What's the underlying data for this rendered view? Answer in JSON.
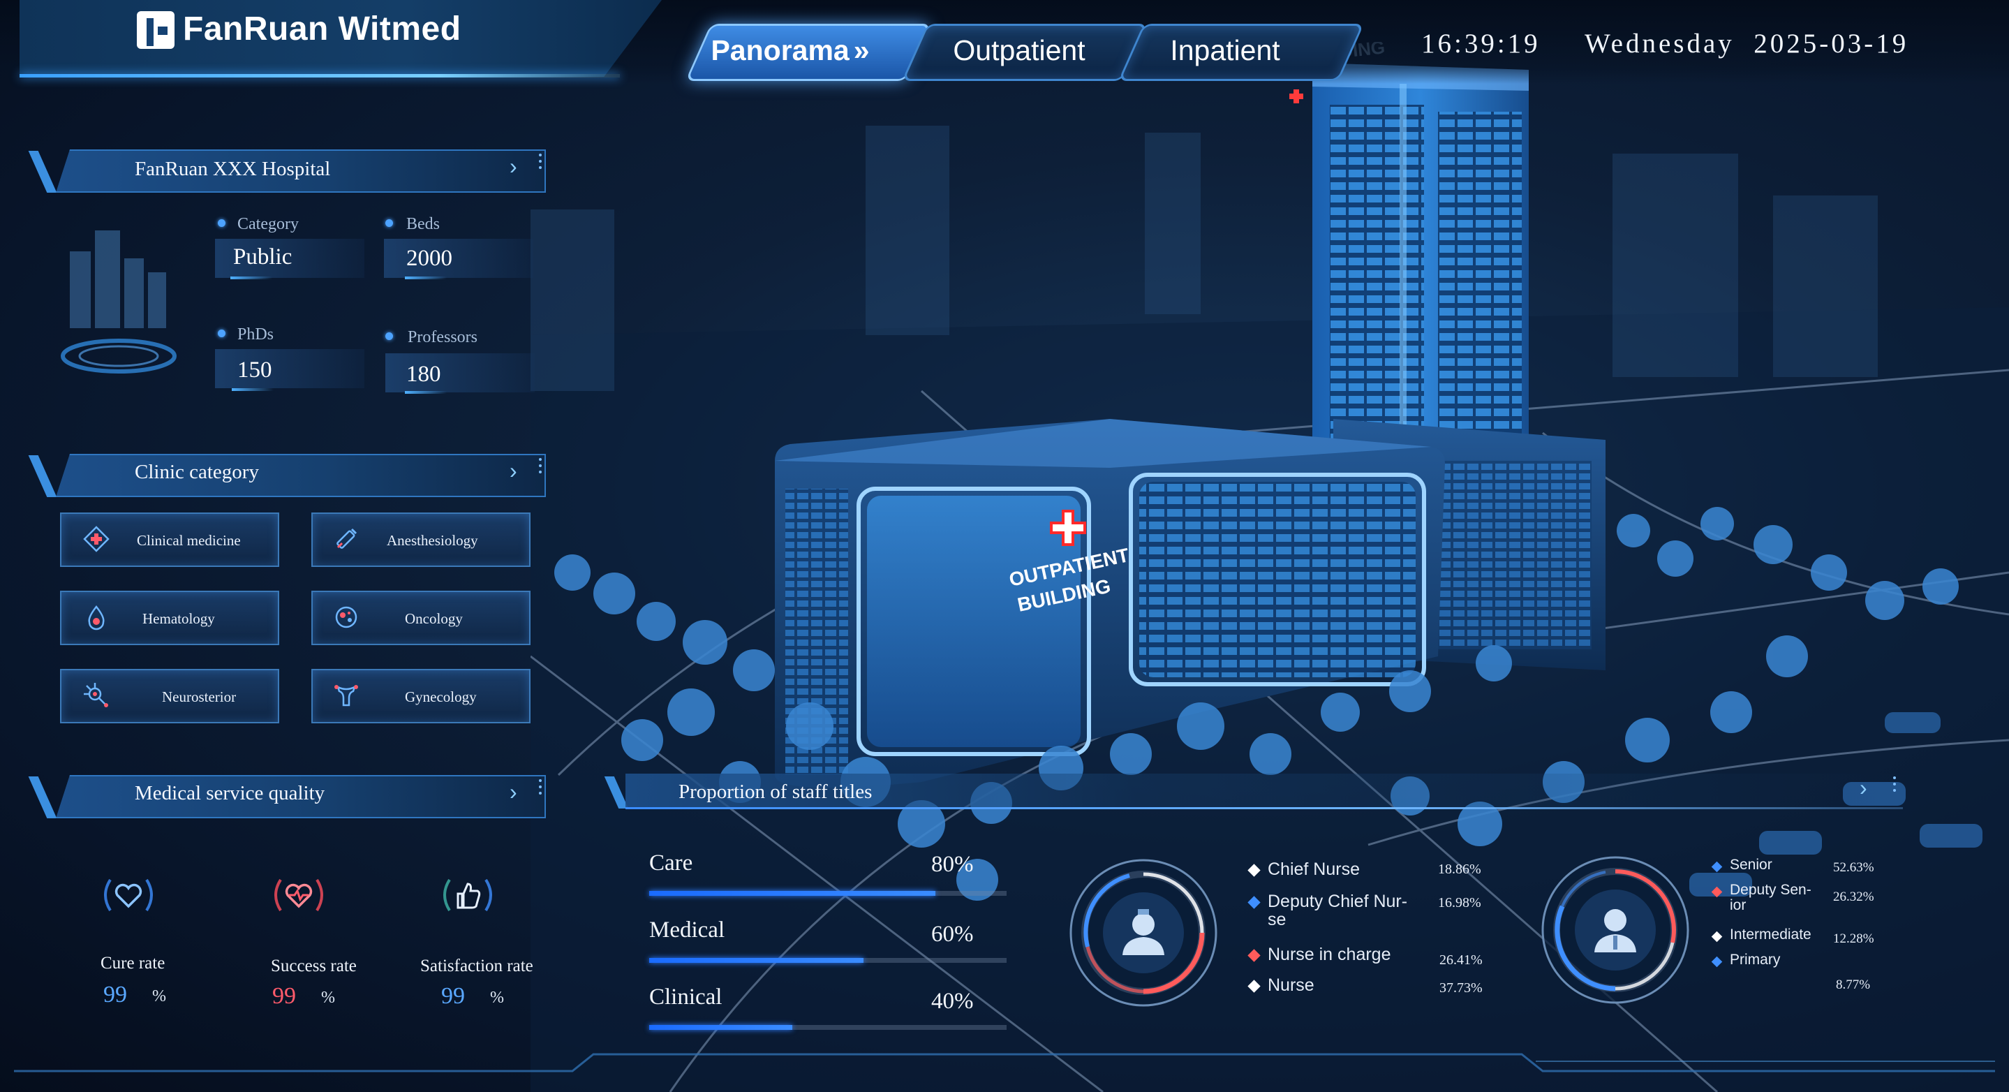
{
  "app": {
    "brand": "FanRuan Witmed"
  },
  "nav": {
    "tabs": [
      {
        "label": "Panorama",
        "active": true
      },
      {
        "label": "Outpatient",
        "active": false
      },
      {
        "label": "Inpatient",
        "active": false
      }
    ],
    "chevron": "»"
  },
  "header": {
    "time": "16:39:19",
    "date": "Wednesday  2025-03-19"
  },
  "scene": {
    "outpatient_sign": [
      "OUTPATIENT",
      "BUILDING"
    ],
    "inpatient_sign": "INPATIENT BUILDING"
  },
  "hospital": {
    "title": "FanRuan XXX Hospital",
    "fields": [
      {
        "key": "Category",
        "value": "Public"
      },
      {
        "key": "Beds",
        "value": "2000"
      },
      {
        "key": "PhDs",
        "value": "150"
      },
      {
        "key": "Professors",
        "value": "180"
      }
    ]
  },
  "clinic": {
    "title": "Clinic category",
    "items": [
      {
        "label": "Clinical medicine",
        "icon": "medical-cross-icon"
      },
      {
        "label": "Anesthesiology",
        "icon": "syringe-icon"
      },
      {
        "label": "Hematology",
        "icon": "blood-drop-icon"
      },
      {
        "label": "Oncology",
        "icon": "cell-icon"
      },
      {
        "label": "Neurosterior",
        "icon": "neuron-icon"
      },
      {
        "label": "Gynecology",
        "icon": "uterus-icon"
      }
    ]
  },
  "quality": {
    "title": "Medical service quality",
    "metrics": [
      {
        "label": "Cure rate",
        "value": "99",
        "unit": "%",
        "color": "#5aa8ff",
        "icon": "heart-icon"
      },
      {
        "label": "Success rate",
        "value": "99",
        "unit": "%",
        "color": "#ff5b6b",
        "icon": "heartbeat-icon"
      },
      {
        "label": "Satisfaction rate",
        "value": "99",
        "unit": "%",
        "color": "#5aa8ff",
        "icon": "thumbs-up-icon"
      }
    ]
  },
  "staff": {
    "title": "Proportion of staff titles",
    "bars": [
      {
        "name": "Care",
        "pct": "80%",
        "value": 0.8
      },
      {
        "name": "Medical",
        "pct": "60%",
        "value": 0.6
      },
      {
        "name": "Clinical",
        "pct": "40%",
        "value": 0.4
      }
    ],
    "nurse_legend": [
      {
        "name": "Chief Nurse",
        "pct": "18.86%",
        "color": "#ffffff"
      },
      {
        "name": "Deputy Chief Nur-\nse",
        "pct": "16.98%",
        "color": "#3f8fff"
      },
      {
        "name": "Nurse in charge",
        "pct": "26.41%",
        "color": "#ff5b5b"
      },
      {
        "name": "Nurse",
        "pct": "37.73%",
        "color": "#ffffff"
      }
    ],
    "doctor_legend": [
      {
        "name": "Senior",
        "pct": "52.63%",
        "color": "#3f8fff"
      },
      {
        "name": "Deputy Sen-\nior",
        "pct": "26.32%",
        "color": "#ff5b5b"
      },
      {
        "name": "Intermediate",
        "pct": "12.28%",
        "color": "#ffffff"
      },
      {
        "name": "Primary",
        "pct": "8.77%",
        "color": "#3f8fff"
      }
    ]
  },
  "colors": {
    "accent": "#3a8cff",
    "alert": "#ff5b6b",
    "panel": "#16406f"
  }
}
